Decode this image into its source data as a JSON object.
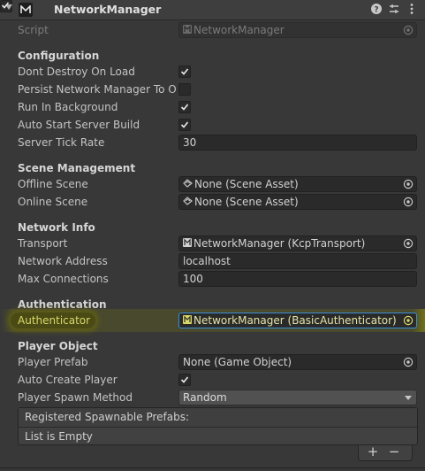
{
  "component": {
    "title": "NetworkManager",
    "enabled": true,
    "header_icons": [
      "help-icon",
      "presets-icon",
      "more-options-icon"
    ]
  },
  "script_row": {
    "label": "Script",
    "value": "NetworkManager"
  },
  "sections": {
    "configuration": "Configuration",
    "scene_management": "Scene Management",
    "network_info": "Network Info",
    "authentication": "Authentication",
    "player_object": "Player Object"
  },
  "configuration": {
    "dont_destroy_on_load": {
      "label": "Dont Destroy On Load",
      "checked": true
    },
    "persist_network_manager": {
      "label": "Persist Network Manager To Offline Scene",
      "checked": false
    },
    "run_in_background": {
      "label": "Run In Background",
      "checked": true
    },
    "auto_start_server_build": {
      "label": "Auto Start Server Build",
      "checked": true
    },
    "server_tick_rate": {
      "label": "Server Tick Rate",
      "value": "30"
    }
  },
  "scene_management": {
    "offline_scene": {
      "label": "Offline Scene",
      "value": "None (Scene Asset)"
    },
    "online_scene": {
      "label": "Online Scene",
      "value": "None (Scene Asset)"
    }
  },
  "network_info": {
    "transport": {
      "label": "Transport",
      "value": "NetworkManager (KcpTransport)"
    },
    "network_address": {
      "label": "Network Address",
      "value": "localhost"
    },
    "max_connections": {
      "label": "Max Connections",
      "value": "100"
    }
  },
  "authentication": {
    "authenticator": {
      "label": "Authenticator",
      "value": "NetworkManager (BasicAuthenticator)"
    }
  },
  "player_object": {
    "player_prefab": {
      "label": "Player Prefab",
      "value": "None (Game Object)"
    },
    "auto_create_player": {
      "label": "Auto Create Player",
      "checked": true
    },
    "player_spawn_method": {
      "label": "Player Spawn Method",
      "value": "Random"
    }
  },
  "spawnable_list": {
    "header": "Registered Spawnable Prefabs:",
    "empty_text": "List is Empty",
    "add_label": "+",
    "remove_label": "−"
  },
  "colors": {
    "background": "#383838",
    "field_background": "#2a2a2a",
    "highlight_yellow": "#d8d86a",
    "focus_blue": "#3c8fd6"
  }
}
